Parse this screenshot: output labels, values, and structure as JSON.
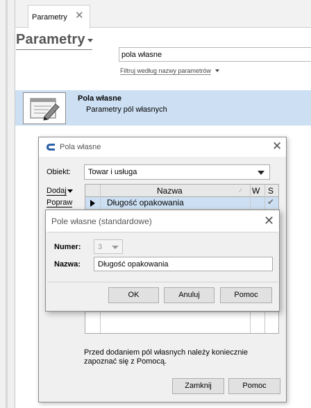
{
  "tab": {
    "label": "Parametry",
    "close_glyph": "✕"
  },
  "header": {
    "title": "Parametry"
  },
  "search": {
    "value": "pola własne",
    "filter_label": "Filtruj według nazwy parametrów"
  },
  "result": {
    "title": "Pola własne",
    "subtitle": "Parametry pól własnych",
    "icon": "edit-document-icon"
  },
  "dialog_main": {
    "title": "Pola własne",
    "close_glyph": "✕",
    "obiekt_label": "Obiekt:",
    "obiekt_value": "Towar i usługa",
    "dodaj_label": "Dodaj",
    "popraw_label": "Popraw",
    "grid": {
      "columns": [
        "Nazwa",
        "W",
        "S"
      ],
      "rows": [
        {
          "name": "Długość opakowania",
          "s_check": "✔"
        }
      ]
    },
    "note": "Przed dodaniem pól własnych należy koniecznie zapoznać się z Pomocą.",
    "close_button": "Zamknij",
    "help_button": "Pomoc"
  },
  "dialog_field": {
    "title": "Pole własne (standardowe)",
    "close_glyph": "✕",
    "numer_label": "Numer:",
    "numer_value": "3",
    "nazwa_label": "Nazwa:",
    "nazwa_value": "Długość opakowania",
    "ok_button": "OK",
    "cancel_button": "Anuluj",
    "help_button": "Pomoc"
  }
}
